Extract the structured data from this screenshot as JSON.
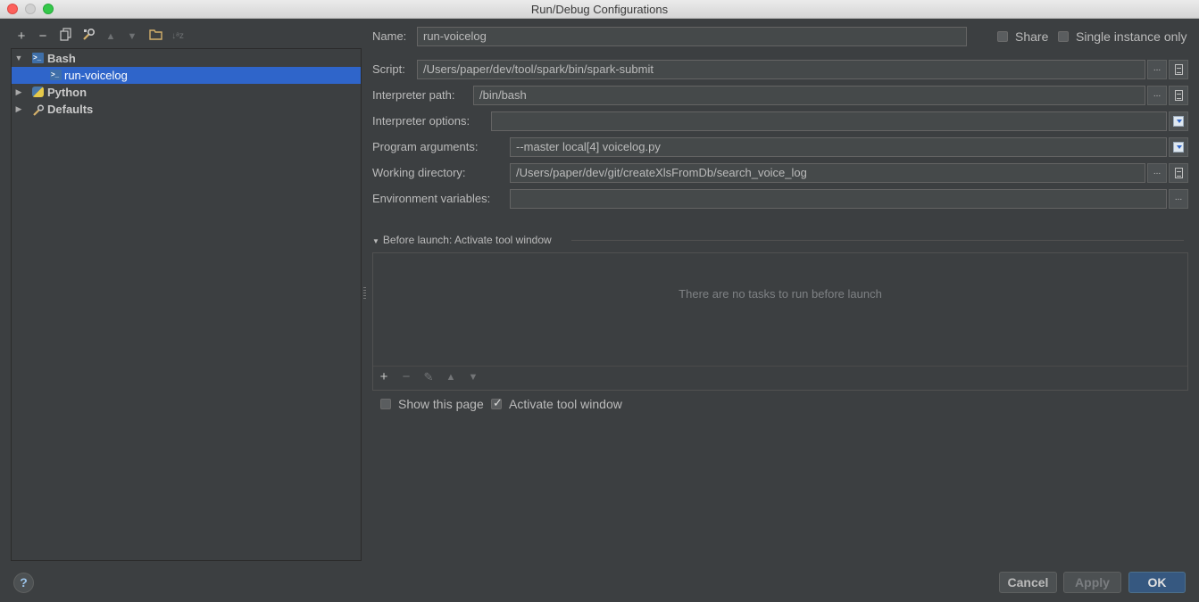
{
  "window": {
    "title": "Run/Debug Configurations"
  },
  "toolbar": {
    "add": "+",
    "remove": "−",
    "move_up": "▲",
    "move_down": "▼",
    "sort": "↓ᵃz"
  },
  "tree": {
    "bash": {
      "label": "Bash",
      "arrow": "▼"
    },
    "run_voicelog": {
      "label": "run-voicelog"
    },
    "python": {
      "label": "Python",
      "arrow": "▶"
    },
    "defaults": {
      "label": "Defaults",
      "arrow": "▶"
    }
  },
  "form": {
    "name": {
      "label": "Name:",
      "value": "run-voicelog"
    },
    "share": {
      "label": "Share",
      "checked": false
    },
    "single_instance": {
      "label": "Single instance only",
      "checked": false
    },
    "script": {
      "label": "Script:",
      "value": "/Users/paper/dev/tool/spark/bin/spark-submit"
    },
    "interpreter_path": {
      "label": "Interpreter path:",
      "value": "/bin/bash"
    },
    "interpreter_options": {
      "label": "Interpreter options:",
      "value": ""
    },
    "program_arguments": {
      "label": "Program arguments:",
      "value": "--master local[4] voicelog.py"
    },
    "working_directory": {
      "label": "Working directory:",
      "value": "/Users/paper/dev/git/createXlsFromDb/search_voice_log"
    },
    "environment_variables": {
      "label": "Environment variables:",
      "value": ""
    },
    "browse": "..."
  },
  "before_launch": {
    "header": "Before launch: Activate tool window",
    "empty_text": "There are no tasks to run before launch",
    "toolbar": {
      "add": "+",
      "remove": "−",
      "edit": "✎",
      "up": "▲",
      "down": "▼"
    }
  },
  "options": {
    "show_this_page": {
      "label": "Show this page",
      "checked": false
    },
    "activate_tool_window": {
      "label": "Activate tool window",
      "checked": true
    }
  },
  "buttons": {
    "help": "?",
    "cancel": "Cancel",
    "apply": "Apply",
    "ok": "OK"
  },
  "colors": {
    "background": "#3c3f41",
    "selection": "#2f65ca",
    "field": "#45494a",
    "primary_button": "#365880"
  }
}
